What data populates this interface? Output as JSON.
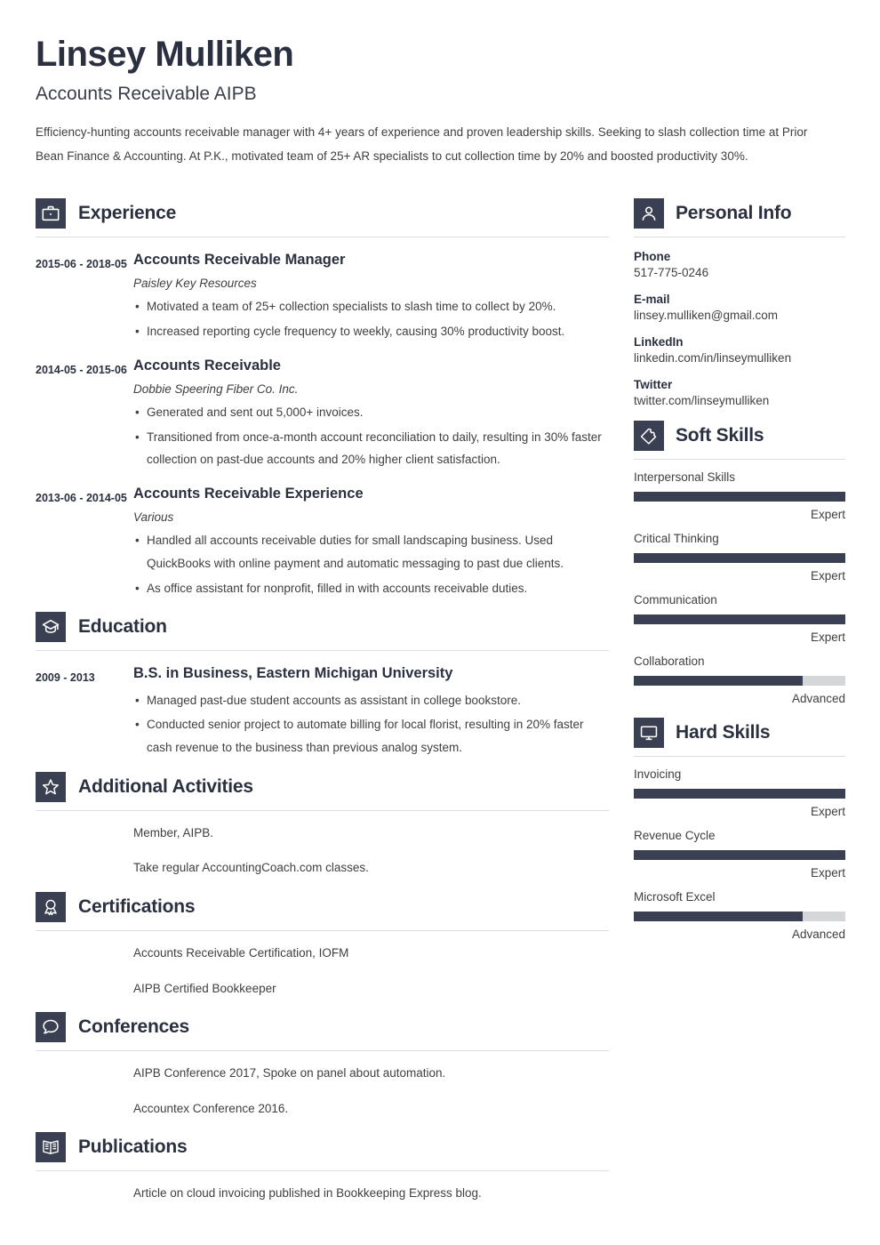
{
  "header": {
    "name": "Linsey Mulliken",
    "job_title": "Accounts Receivable AIPB",
    "summary": "Efficiency-hunting accounts receivable manager with 4+ years of experience and proven leadership skills. Seeking to slash collection time at Prior Bean Finance & Accounting. At P.K., motivated team of 25+ AR specialists to cut collection time by 20% and boosted productivity 30%."
  },
  "experience": {
    "title": "Experience",
    "icon": "briefcase-icon",
    "entries": [
      {
        "dates": "2015-06 - 2018-05",
        "title": "Accounts Receivable Manager",
        "org": "Paisley Key Resources",
        "bullets": [
          "Motivated a team of 25+ collection specialists to slash time to collect by 20%.",
          "Increased reporting cycle frequency to weekly, causing 30% productivity boost."
        ]
      },
      {
        "dates": "2014-05 - 2015-06",
        "title": "Accounts Receivable",
        "org": "Dobbie Speering Fiber Co. Inc.",
        "bullets": [
          "Generated and sent out 5,000+ invoices.",
          "Transitioned from once-a-month account reconciliation to daily, resulting in 30% faster collection on past-due accounts and 20% higher client satisfaction."
        ]
      },
      {
        "dates": "2013-06 - 2014-05",
        "title": "Accounts Receivable Experience",
        "org": "Various",
        "bullets": [
          "Handled all accounts receivable duties for small landscaping business. Used QuickBooks with online payment and automatic messaging to past due clients.",
          "As office assistant for nonprofit, filled in with accounts receivable duties."
        ]
      }
    ]
  },
  "education": {
    "title": "Education",
    "icon": "graduation-cap-icon",
    "entries": [
      {
        "dates": "2009 - 2013",
        "title": "B.S. in Business, Eastern Michigan University",
        "bullets": [
          "Managed past-due student accounts as assistant in college bookstore.",
          "Conducted senior project to automate billing for local florist, resulting in 20% faster cash revenue to the business than previous analog system."
        ]
      }
    ]
  },
  "additional_activities": {
    "title": "Additional Activities",
    "icon": "star-icon",
    "items": [
      "Member, AIPB.",
      "Take regular AccountingCoach.com classes."
    ]
  },
  "certifications": {
    "title": "Certifications",
    "icon": "award-ribbon-icon",
    "items": [
      "Accounts Receivable Certification, IOFM",
      "AIPB Certified Bookkeeper"
    ]
  },
  "conferences": {
    "title": "Conferences",
    "icon": "speech-bubble-icon",
    "items": [
      "AIPB Conference 2017, Spoke on panel about automation.",
      "Accountex Conference 2016."
    ]
  },
  "publications": {
    "title": "Publications",
    "icon": "open-book-icon",
    "items": [
      "Article on cloud invoicing published in Bookkeeping Express blog."
    ]
  },
  "personal_info": {
    "title": "Personal Info",
    "icon": "person-icon",
    "fields": [
      {
        "label": "Phone",
        "value": "517-775-0246"
      },
      {
        "label": "E-mail",
        "value": "linsey.mulliken@gmail.com"
      },
      {
        "label": "LinkedIn",
        "value": "linkedin.com/in/linseymulliken"
      },
      {
        "label": "Twitter",
        "value": "twitter.com/linseymulliken"
      }
    ]
  },
  "soft_skills": {
    "title": "Soft Skills",
    "icon": "puzzle-piece-icon",
    "skills": [
      {
        "name": "Interpersonal Skills",
        "level": "Expert",
        "percent": 100
      },
      {
        "name": "Critical Thinking",
        "level": "Expert",
        "percent": 100
      },
      {
        "name": "Communication",
        "level": "Expert",
        "percent": 100
      },
      {
        "name": "Collaboration",
        "level": "Advanced",
        "percent": 80
      }
    ]
  },
  "hard_skills": {
    "title": "Hard Skills",
    "icon": "monitor-icon",
    "skills": [
      {
        "name": "Invoicing",
        "level": "Expert",
        "percent": 100
      },
      {
        "name": "Revenue Cycle",
        "level": "Expert",
        "percent": 100
      },
      {
        "name": "Microsoft Excel",
        "level": "Advanced",
        "percent": 80
      }
    ]
  },
  "colors": {
    "accent_dark": "#3a4052",
    "heading": "#2b3040",
    "body_text": "#3f3f3f",
    "rule": "#dddddd",
    "bar_track": "#d4d6d8"
  }
}
